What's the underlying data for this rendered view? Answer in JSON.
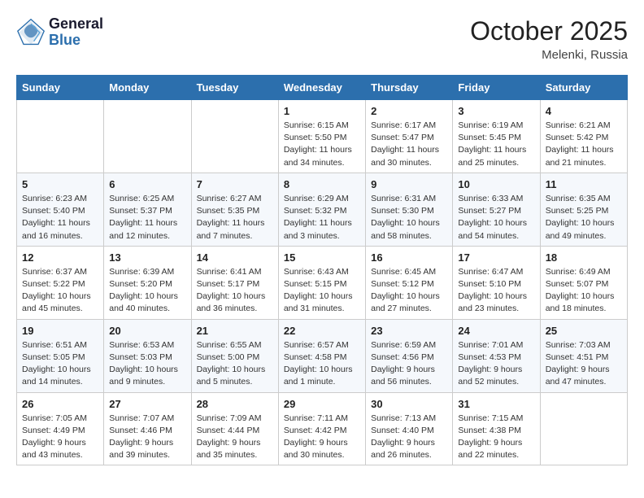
{
  "logo": {
    "line1": "General",
    "line2": "Blue"
  },
  "title": "October 2025",
  "location": "Melenki, Russia",
  "days_header": [
    "Sunday",
    "Monday",
    "Tuesday",
    "Wednesday",
    "Thursday",
    "Friday",
    "Saturday"
  ],
  "weeks": [
    [
      {
        "day": "",
        "info": ""
      },
      {
        "day": "",
        "info": ""
      },
      {
        "day": "",
        "info": ""
      },
      {
        "day": "1",
        "info": "Sunrise: 6:15 AM\nSunset: 5:50 PM\nDaylight: 11 hours\nand 34 minutes."
      },
      {
        "day": "2",
        "info": "Sunrise: 6:17 AM\nSunset: 5:47 PM\nDaylight: 11 hours\nand 30 minutes."
      },
      {
        "day": "3",
        "info": "Sunrise: 6:19 AM\nSunset: 5:45 PM\nDaylight: 11 hours\nand 25 minutes."
      },
      {
        "day": "4",
        "info": "Sunrise: 6:21 AM\nSunset: 5:42 PM\nDaylight: 11 hours\nand 21 minutes."
      }
    ],
    [
      {
        "day": "5",
        "info": "Sunrise: 6:23 AM\nSunset: 5:40 PM\nDaylight: 11 hours\nand 16 minutes."
      },
      {
        "day": "6",
        "info": "Sunrise: 6:25 AM\nSunset: 5:37 PM\nDaylight: 11 hours\nand 12 minutes."
      },
      {
        "day": "7",
        "info": "Sunrise: 6:27 AM\nSunset: 5:35 PM\nDaylight: 11 hours\nand 7 minutes."
      },
      {
        "day": "8",
        "info": "Sunrise: 6:29 AM\nSunset: 5:32 PM\nDaylight: 11 hours\nand 3 minutes."
      },
      {
        "day": "9",
        "info": "Sunrise: 6:31 AM\nSunset: 5:30 PM\nDaylight: 10 hours\nand 58 minutes."
      },
      {
        "day": "10",
        "info": "Sunrise: 6:33 AM\nSunset: 5:27 PM\nDaylight: 10 hours\nand 54 minutes."
      },
      {
        "day": "11",
        "info": "Sunrise: 6:35 AM\nSunset: 5:25 PM\nDaylight: 10 hours\nand 49 minutes."
      }
    ],
    [
      {
        "day": "12",
        "info": "Sunrise: 6:37 AM\nSunset: 5:22 PM\nDaylight: 10 hours\nand 45 minutes."
      },
      {
        "day": "13",
        "info": "Sunrise: 6:39 AM\nSunset: 5:20 PM\nDaylight: 10 hours\nand 40 minutes."
      },
      {
        "day": "14",
        "info": "Sunrise: 6:41 AM\nSunset: 5:17 PM\nDaylight: 10 hours\nand 36 minutes."
      },
      {
        "day": "15",
        "info": "Sunrise: 6:43 AM\nSunset: 5:15 PM\nDaylight: 10 hours\nand 31 minutes."
      },
      {
        "day": "16",
        "info": "Sunrise: 6:45 AM\nSunset: 5:12 PM\nDaylight: 10 hours\nand 27 minutes."
      },
      {
        "day": "17",
        "info": "Sunrise: 6:47 AM\nSunset: 5:10 PM\nDaylight: 10 hours\nand 23 minutes."
      },
      {
        "day": "18",
        "info": "Sunrise: 6:49 AM\nSunset: 5:07 PM\nDaylight: 10 hours\nand 18 minutes."
      }
    ],
    [
      {
        "day": "19",
        "info": "Sunrise: 6:51 AM\nSunset: 5:05 PM\nDaylight: 10 hours\nand 14 minutes."
      },
      {
        "day": "20",
        "info": "Sunrise: 6:53 AM\nSunset: 5:03 PM\nDaylight: 10 hours\nand 9 minutes."
      },
      {
        "day": "21",
        "info": "Sunrise: 6:55 AM\nSunset: 5:00 PM\nDaylight: 10 hours\nand 5 minutes."
      },
      {
        "day": "22",
        "info": "Sunrise: 6:57 AM\nSunset: 4:58 PM\nDaylight: 10 hours\nand 1 minute."
      },
      {
        "day": "23",
        "info": "Sunrise: 6:59 AM\nSunset: 4:56 PM\nDaylight: 9 hours\nand 56 minutes."
      },
      {
        "day": "24",
        "info": "Sunrise: 7:01 AM\nSunset: 4:53 PM\nDaylight: 9 hours\nand 52 minutes."
      },
      {
        "day": "25",
        "info": "Sunrise: 7:03 AM\nSunset: 4:51 PM\nDaylight: 9 hours\nand 47 minutes."
      }
    ],
    [
      {
        "day": "26",
        "info": "Sunrise: 7:05 AM\nSunset: 4:49 PM\nDaylight: 9 hours\nand 43 minutes."
      },
      {
        "day": "27",
        "info": "Sunrise: 7:07 AM\nSunset: 4:46 PM\nDaylight: 9 hours\nand 39 minutes."
      },
      {
        "day": "28",
        "info": "Sunrise: 7:09 AM\nSunset: 4:44 PM\nDaylight: 9 hours\nand 35 minutes."
      },
      {
        "day": "29",
        "info": "Sunrise: 7:11 AM\nSunset: 4:42 PM\nDaylight: 9 hours\nand 30 minutes."
      },
      {
        "day": "30",
        "info": "Sunrise: 7:13 AM\nSunset: 4:40 PM\nDaylight: 9 hours\nand 26 minutes."
      },
      {
        "day": "31",
        "info": "Sunrise: 7:15 AM\nSunset: 4:38 PM\nDaylight: 9 hours\nand 22 minutes."
      },
      {
        "day": "",
        "info": ""
      }
    ]
  ]
}
